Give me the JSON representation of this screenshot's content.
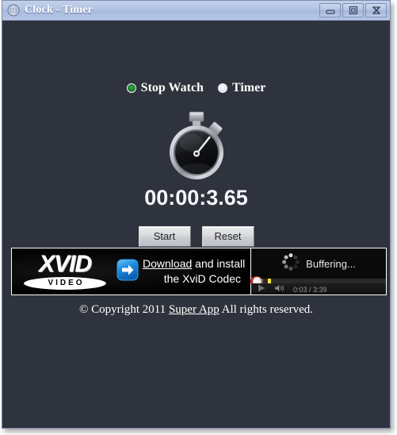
{
  "window": {
    "title": "Clock - Timer",
    "icon": "globe-icon",
    "controls": {
      "minimize": "minimize",
      "maximize": "maximize",
      "close": "close"
    },
    "colors": {
      "titlebar": "#b0c1e2",
      "client_background": "#2f333d",
      "frame_border": "#7b8ab0",
      "accent_green": "#2faa3f",
      "scrubber_red": "#c0231f"
    }
  },
  "modes": {
    "options": [
      {
        "label": "Stop Watch",
        "selected": true
      },
      {
        "label": "Timer",
        "selected": false
      }
    ],
    "stopwatch_label": "Stop Watch",
    "timer_label": "Timer"
  },
  "stopwatch": {
    "icon": "stopwatch-icon",
    "time": "00:00:3.65"
  },
  "buttons": {
    "start": "Start",
    "reset": "Reset"
  },
  "advertisement": {
    "brand": {
      "word": "XVID",
      "subtitle": "VIDEO"
    },
    "arrow_icon": "blue-arrow-icon",
    "link_text": "Download",
    "text_after_link": " and install",
    "line2": "the XviD Codec",
    "video": {
      "status": "Buffering...",
      "spinner_icon": "loading-spinner-icon",
      "play_icon": "play-icon",
      "volume_icon": "volume-icon",
      "current_time": "0:03",
      "separator": " / ",
      "total_time": "3:39",
      "timecode": "0:03 / 3:39"
    }
  },
  "footer": {
    "prefix": "© Copyright 2011 ",
    "link": "Super App",
    "suffix": " All rights reserved."
  }
}
